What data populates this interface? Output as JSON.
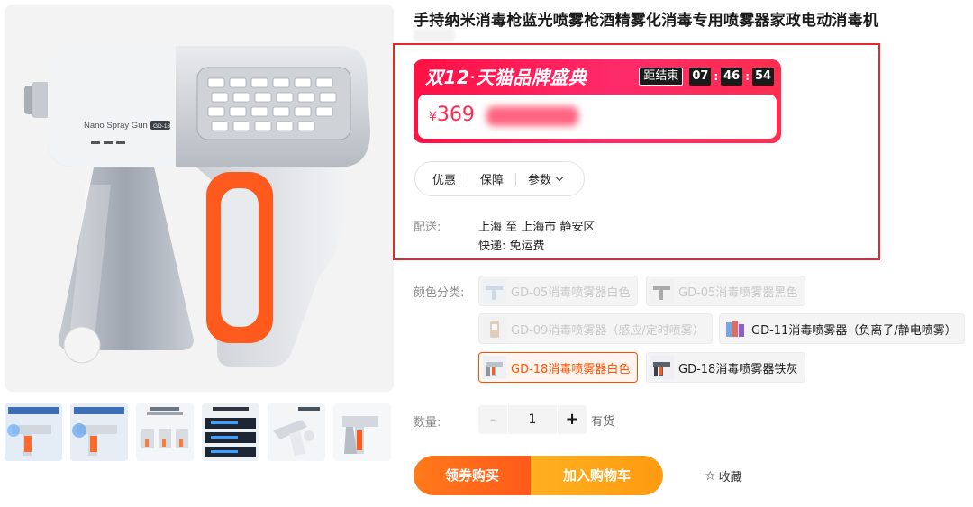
{
  "product": {
    "title": "手持纳米消毒枪蓝光喷雾枪酒精雾化消毒专用喷雾器家政电动消毒机",
    "image_text": "Nano Spray Gun",
    "image_badge": "GD-18"
  },
  "promo": {
    "title": "双12",
    "dot": "·",
    "title_rest": "天猫品牌盛典",
    "countdown_label": "距结束",
    "hours": "07",
    "minutes": "46",
    "seconds": "54",
    "separator": ":",
    "currency": "¥",
    "price": "369"
  },
  "tabs": {
    "discount": "优惠",
    "guarantee": "保障",
    "params": "参数"
  },
  "delivery": {
    "label": "配送:",
    "destination": "上海 至 上海市 静安区",
    "fee": "快递: 免运费"
  },
  "color": {
    "label": "颜色分类:",
    "options": [
      {
        "label": "GD-05消毒喷雾器白色",
        "state": "disabled"
      },
      {
        "label": "GD-05消毒喷雾器黑色",
        "state": "disabled"
      },
      {
        "label": "GD-09消毒喷雾器（感应/定时喷雾）",
        "state": "disabled"
      },
      {
        "label": "GD-11消毒喷雾器（负离子/静电喷雾）",
        "state": "available"
      },
      {
        "label": "GD-18消毒喷雾器白色",
        "state": "selected"
      },
      {
        "label": "GD-18消毒喷雾器铁灰",
        "state": "available"
      }
    ]
  },
  "quantity": {
    "label": "数量:",
    "value": "1",
    "minus": "-",
    "plus": "+",
    "stock": "有货"
  },
  "actions": {
    "coupon_buy": "领券购买",
    "add_to_cart": "加入购物车",
    "favorite_icon": "☆",
    "favorite": "收藏"
  },
  "colors": {
    "promo_red": "#ff1a4b",
    "price_red": "#ff2a50",
    "accent_orange": "#ff5000",
    "highlight_border": "#e5292e"
  }
}
